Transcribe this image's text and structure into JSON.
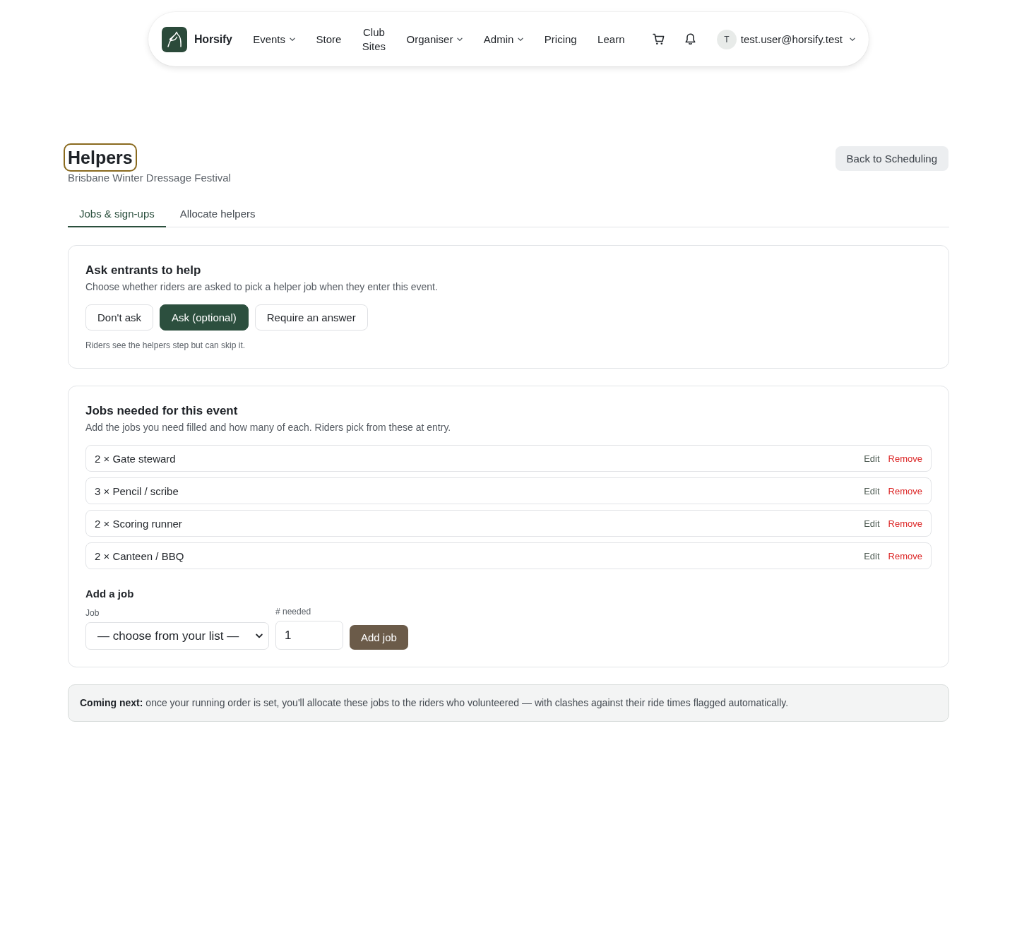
{
  "nav": {
    "brand": "Horsify",
    "items": [
      {
        "label": "Events",
        "dropdown": true
      },
      {
        "label": "Store",
        "dropdown": false
      },
      {
        "label": "Club Sites",
        "dropdown": false
      },
      {
        "label": "Organiser",
        "dropdown": true
      },
      {
        "label": "Admin",
        "dropdown": true
      },
      {
        "label": "Pricing",
        "dropdown": false
      },
      {
        "label": "Learn",
        "dropdown": false
      }
    ],
    "user": {
      "initial": "T",
      "email": "test.user@horsify.test"
    }
  },
  "header": {
    "title": "Helpers",
    "focused": true,
    "subtitle": "Brisbane Winter Dressage Festival",
    "back_button": "Back to Scheduling"
  },
  "tabs": [
    {
      "label": "Jobs & sign-ups",
      "selected": true
    },
    {
      "label": "Allocate helpers",
      "selected": false
    }
  ],
  "ask_card": {
    "title": "Ask entrants to help",
    "description": "Choose whether riders are asked to pick a helper job when they enter this event.",
    "options": [
      {
        "label": "Don't ask",
        "selected": false
      },
      {
        "label": "Ask (optional)",
        "selected": true
      },
      {
        "label": "Require an answer",
        "selected": false
      }
    ],
    "hint": "Riders see the helpers step but can skip it."
  },
  "jobs_card": {
    "title": "Jobs needed for this event",
    "description": "Add the jobs you need filled and how many of each. Riders pick from these at entry.",
    "jobs": [
      {
        "text": "2 × Gate steward",
        "edit": "Edit",
        "remove": "Remove"
      },
      {
        "text": "3 × Pencil / scribe",
        "edit": "Edit",
        "remove": "Remove"
      },
      {
        "text": "2 × Scoring runner",
        "edit": "Edit",
        "remove": "Remove"
      },
      {
        "text": "2 × Canteen / BBQ",
        "edit": "Edit",
        "remove": "Remove"
      }
    ],
    "add_job": {
      "title": "Add a job",
      "job_label": "Job",
      "job_value": "— choose from your list —",
      "count_label": "# needed",
      "count_value": "1",
      "button": "Add job"
    }
  },
  "note": {
    "text": "**Coming next:** once your running order is set, you'll allocate these jobs to the riders who volunteered — with clashes against their ride times flagged automatically."
  }
}
